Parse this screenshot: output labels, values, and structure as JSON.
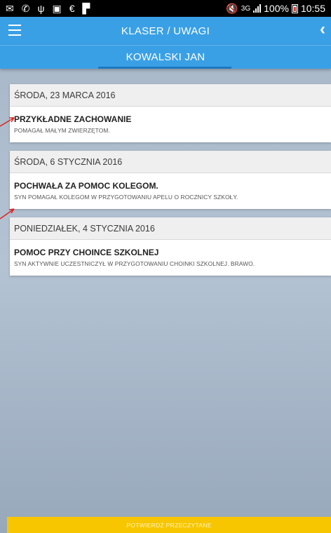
{
  "status_bar": {
    "network": "3G",
    "battery": "100%",
    "time": "10:55",
    "left_icons": [
      "mail-icon",
      "call-icon",
      "usb-icon",
      "gallery-icon",
      "font-icon",
      "flag-icon"
    ]
  },
  "app_bar": {
    "title": "KLASER / UWAGI"
  },
  "sub_bar": {
    "title": "KOWALSKI JAN"
  },
  "notes": [
    {
      "date": "ŚRODA, 23 MARCA 2016",
      "title": "PRZYKŁADNE ZACHOWANIE",
      "text": "POMAGAŁ MAŁYM ZWIERZĘTOM."
    },
    {
      "date": "ŚRODA, 6 STYCZNIA 2016",
      "title": "POCHWAŁA ZA POMOC KOLEGOM.",
      "text": "SYN POMAGAŁ KOLEGOM W PRZYGOTOWANIU APELU O ROCZNICY SZKOŁY."
    },
    {
      "date": "PONIEDZIAŁEK, 4 STYCZNIA 2016",
      "title": "POMOC PRZY CHOINCE SZKOLNEJ",
      "text": "SYN AKTYWNIE UCZESTNICZYŁ W PRZYGOTOWANIU CHOINKI SZKOLNEJ. BRAWO."
    }
  ],
  "confirm_button": {
    "label": "POTWIERDŹ PRZECZYTANE"
  },
  "colors": {
    "primary": "#3aa0e6",
    "accent": "#f7c600",
    "annotation_arrow": "#e0201c"
  }
}
